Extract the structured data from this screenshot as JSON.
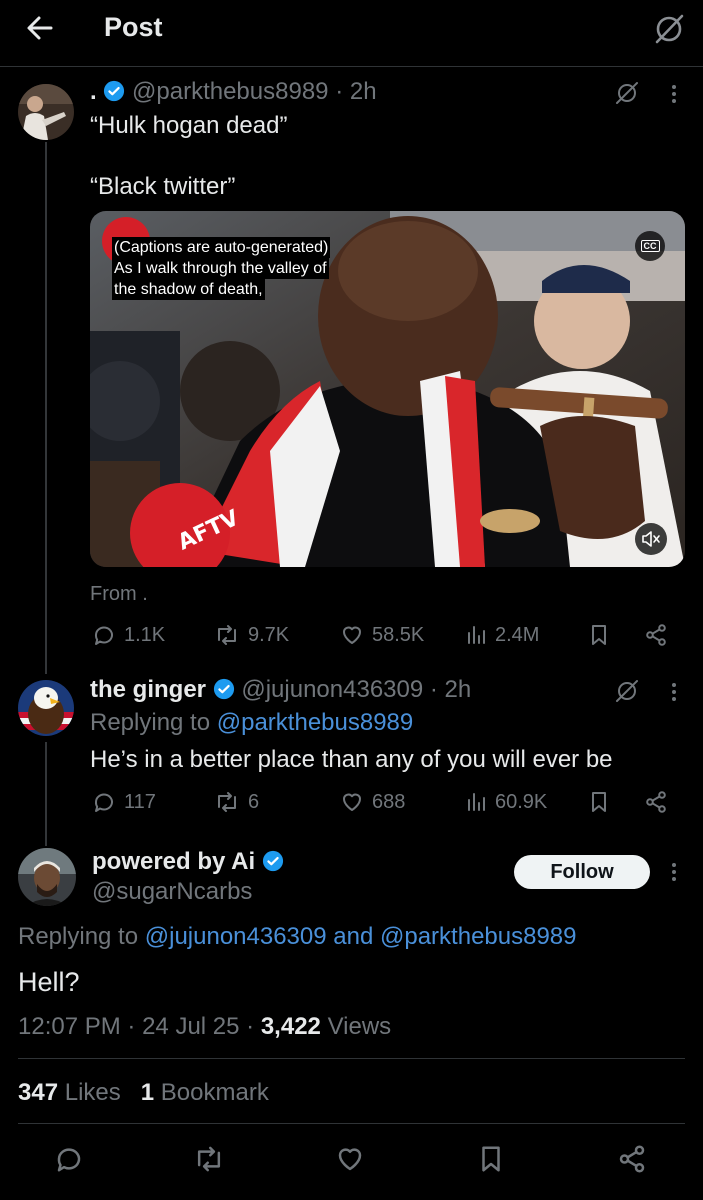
{
  "header": {
    "title": "Post"
  },
  "tweet1": {
    "handle_prefix": ".",
    "handle": "@parkthebus8989",
    "time": "· 2h",
    "line1": "“Hulk hogan dead”",
    "line2": "“Black twitter”",
    "video": {
      "captions": [
        "(Captions are auto-generated)",
        "As I walk through the valley of",
        "the shadow of death,"
      ],
      "cc_label": "CC",
      "logo_text": "AFTV"
    },
    "from_label": "From .",
    "stats": {
      "replies": "1.1K",
      "reposts": "9.7K",
      "likes": "58.5K",
      "views": "2.4M"
    }
  },
  "tweet2": {
    "name": "the ginger",
    "handle": "@jujunon436309",
    "time": "· 2h",
    "replying_prefix": "Replying to",
    "replying_to": "@parkthebus8989",
    "text": "He’s in a better place than any of you will ever be",
    "stats": {
      "replies": "117",
      "reposts": "6",
      "likes": "688",
      "views": "60.9K"
    }
  },
  "main_tweet": {
    "name": "powered by Ai",
    "handle": "@sugarNcarbs",
    "follow_label": "Follow",
    "replying_prefix": "Replying to",
    "replying_to_1": "@jujunon436309",
    "replying_and": "and",
    "replying_to_2": "@parkthebus8989",
    "text": "Hell?",
    "time": "12:07 PM",
    "date": "24 Jul 25",
    "views_count": "3,422",
    "views_label": "Views",
    "likes_count": "347",
    "likes_label": "Likes",
    "bookmarks_count": "1",
    "bookmarks_label": "Bookmark"
  },
  "colors": {
    "accent": "#1d9bf0",
    "link": "#4a90d9",
    "muted": "#71767b",
    "background": "#000000",
    "text": "#e7e9ea"
  }
}
